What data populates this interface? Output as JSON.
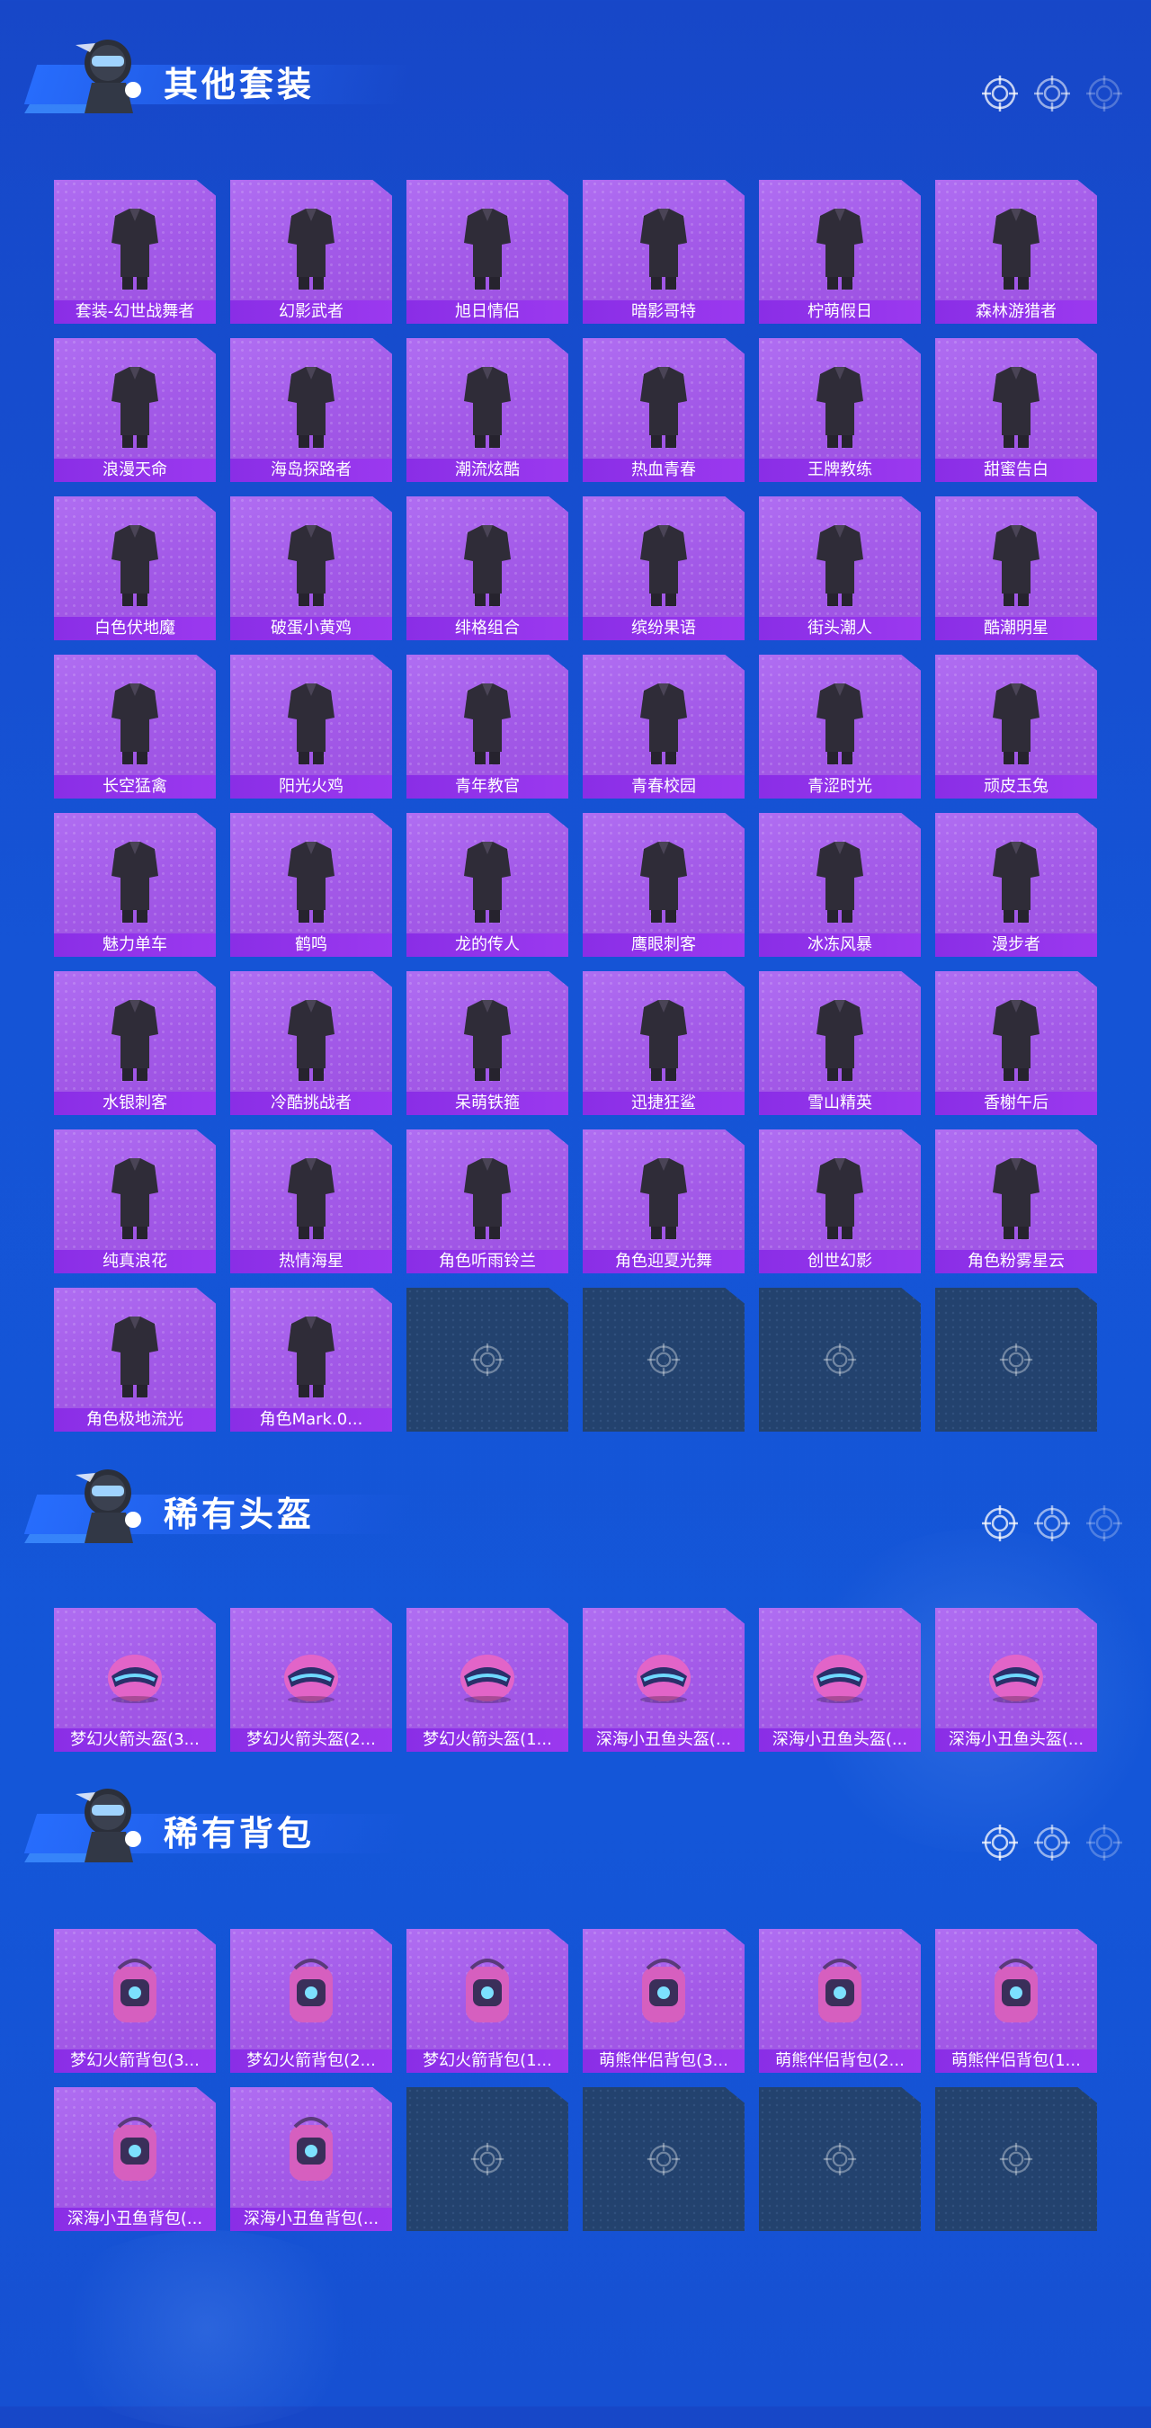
{
  "colors": {
    "background": "#1650d2",
    "card": "#a35ae8",
    "label_bar": "#8a2ee6",
    "empty_card": "#23426e",
    "title": "#ffffff"
  },
  "sections": [
    {
      "title": "其他套装",
      "item_type": "outfit",
      "items": [
        "套装-幻世战舞者",
        "幻影武者",
        "旭日情侣",
        "暗影哥特",
        "柠萌假日",
        "森林游猎者",
        "浪漫天命",
        "海岛探路者",
        "潮流炫酷",
        "热血青春",
        "王牌教练",
        "甜蜜告白",
        "白色伏地魔",
        "破蛋小黄鸡",
        "绯格组合",
        "缤纷果语",
        "街头潮人",
        "酷潮明星",
        "长空猛禽",
        "阳光火鸡",
        "青年教官",
        "青春校园",
        "青涩时光",
        "顽皮玉兔",
        "魅力单车",
        "鹤鸣",
        "龙的传人",
        "鹰眼刺客",
        "冰冻风暴",
        "漫步者",
        "水银刺客",
        "冷酷挑战者",
        "呆萌铁箍",
        "迅捷狂鲨",
        "雪山精英",
        "香榭午后",
        "纯真浪花",
        "热情海星",
        "角色听雨铃兰",
        "角色迎夏光舞",
        "创世幻影",
        "角色粉雾星云",
        "角色极地流光",
        "角色Mark.0..."
      ],
      "empty_slots": 4
    },
    {
      "title": "稀有头盔",
      "item_type": "helmet",
      "items": [
        "梦幻火箭头盔(3...",
        "梦幻火箭头盔(2...",
        "梦幻火箭头盔(1...",
        "深海小丑鱼头盔(...",
        "深海小丑鱼头盔(...",
        "深海小丑鱼头盔(..."
      ],
      "empty_slots": 0
    },
    {
      "title": "稀有背包",
      "item_type": "backpack",
      "items": [
        "梦幻火箭背包(3...",
        "梦幻火箭背包(2...",
        "梦幻火箭背包(1...",
        "萌熊伴侣背包(3...",
        "萌熊伴侣背包(2...",
        "萌熊伴侣背包(1...",
        "深海小丑鱼背包(...",
        "深海小丑鱼背包(..."
      ],
      "empty_slots": 4
    }
  ]
}
